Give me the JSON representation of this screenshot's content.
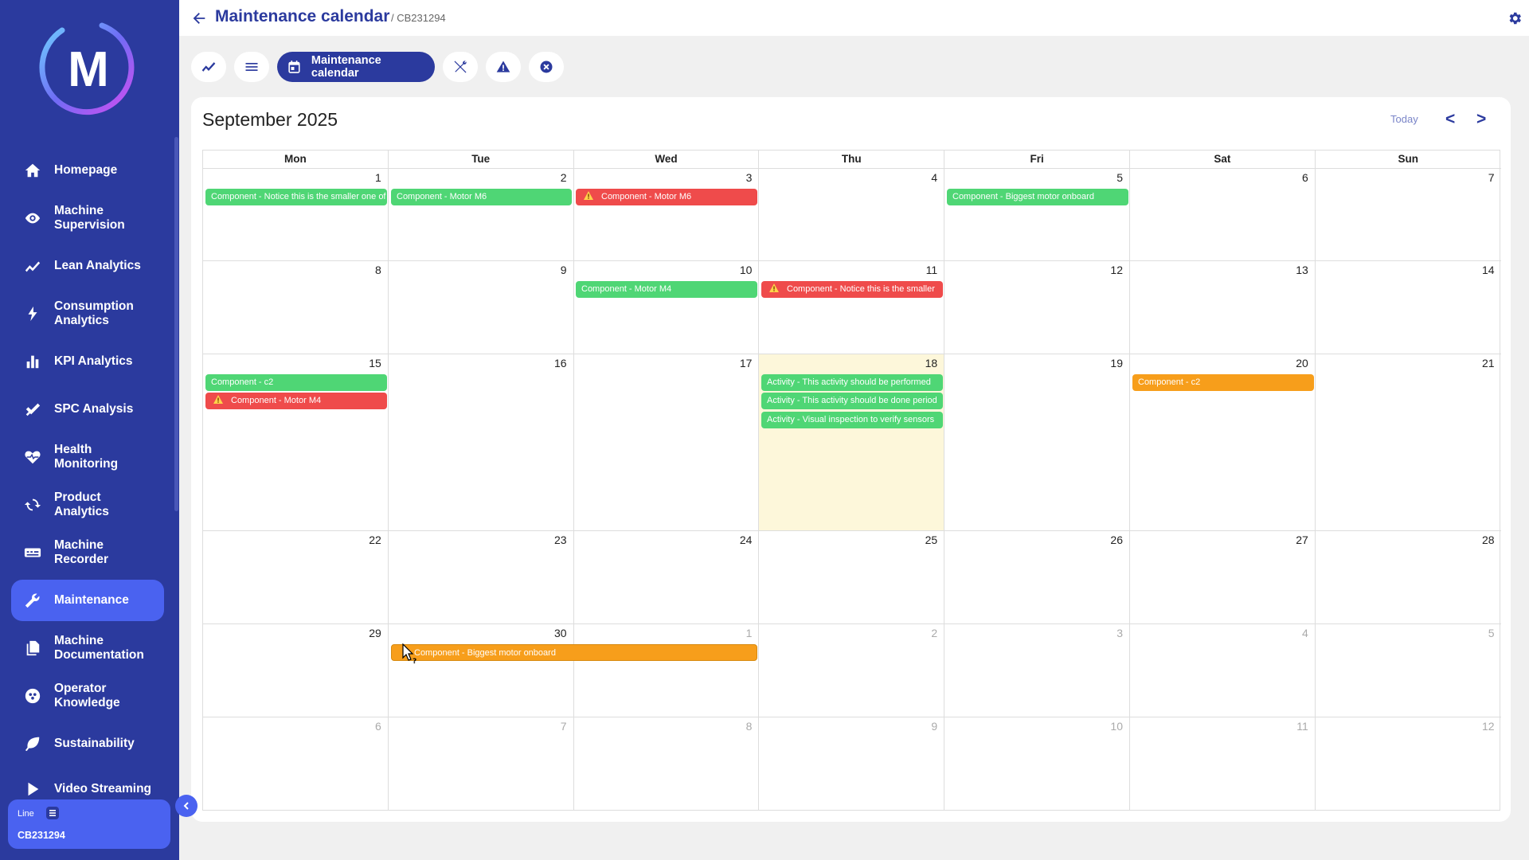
{
  "sidebar": {
    "logo_letter": "M",
    "items": [
      {
        "label": "Homepage",
        "icon": "home-icon"
      },
      {
        "label": "Machine Supervision",
        "icon": "eye-icon"
      },
      {
        "label": "Lean Analytics",
        "icon": "trend-icon"
      },
      {
        "label": "Consumption Analytics",
        "icon": "bolt-icon"
      },
      {
        "label": "KPI Analytics",
        "icon": "bar-chart-icon"
      },
      {
        "label": "SPC Analysis",
        "icon": "check-chart-icon"
      },
      {
        "label": "Health Monitoring",
        "icon": "heart-pulse-icon"
      },
      {
        "label": "Product Analytics",
        "icon": "cycle-icon"
      },
      {
        "label": "Machine Recorder",
        "icon": "recorder-icon"
      },
      {
        "label": "Maintenance",
        "icon": "wrench-icon",
        "active": true
      },
      {
        "label": "Machine Documentation",
        "icon": "documents-icon"
      },
      {
        "label": "Operator Knowledge",
        "icon": "brain-icon"
      },
      {
        "label": "Sustainability",
        "icon": "leaf-icon"
      },
      {
        "label": "Video Streaming",
        "icon": "play-icon"
      }
    ],
    "line_label": "Line",
    "line_value": "CB231294"
  },
  "header": {
    "title": "Maintenance calendar",
    "breadcrumb": "/ CB231294"
  },
  "toolbar": {
    "active_label": "Maintenance calendar",
    "buttons": [
      "trend-icon",
      "list-icon",
      "calendar-icon",
      "tools-icon",
      "warning-icon",
      "close-circle-icon"
    ]
  },
  "calendar": {
    "month_title": "September 2025",
    "today_label": "Today",
    "prev_label": "<",
    "next_label": ">",
    "weekdays": [
      "Mon",
      "Tue",
      "Wed",
      "Thu",
      "Fri",
      "Sat",
      "Sun"
    ],
    "weeks": [
      [
        "1",
        "2",
        "3",
        "4",
        "5",
        "6",
        "7"
      ],
      [
        "8",
        "9",
        "10",
        "11",
        "12",
        "13",
        "14"
      ],
      [
        "15",
        "16",
        "17",
        "18",
        "19",
        "20",
        "21"
      ],
      [
        "22",
        "23",
        "24",
        "25",
        "26",
        "27",
        "28"
      ],
      [
        "29",
        "30",
        "1",
        "2",
        "3",
        "4",
        "5"
      ],
      [
        "6",
        "7",
        "8",
        "9",
        "10",
        "11",
        "12"
      ]
    ],
    "events": {
      "e1": "Component - Notice this is the smaller one of",
      "e2": "Component - Motor M6",
      "e3": "Component - Motor M6",
      "e4": "Component - Biggest motor onboard",
      "e5": "Component - Motor M4",
      "e6": "Component - Notice this is the smaller",
      "e7": "Component - c2",
      "e8": "Component - Motor M4",
      "e9": "Activity - This activity should be performed",
      "e10": "Activity - This activity should be done period",
      "e11": "Activity - Visual inspection to verify sensors",
      "e12": "Component - c2",
      "e13": "Component - Biggest motor onboard"
    },
    "colors": {
      "green": "#4fd675",
      "red": "#ef4b4b",
      "orange": "#f79e1b",
      "today": "#fdf7da"
    }
  },
  "theme": {
    "primary": "#2b3a9e",
    "accent": "#4a62f0"
  }
}
